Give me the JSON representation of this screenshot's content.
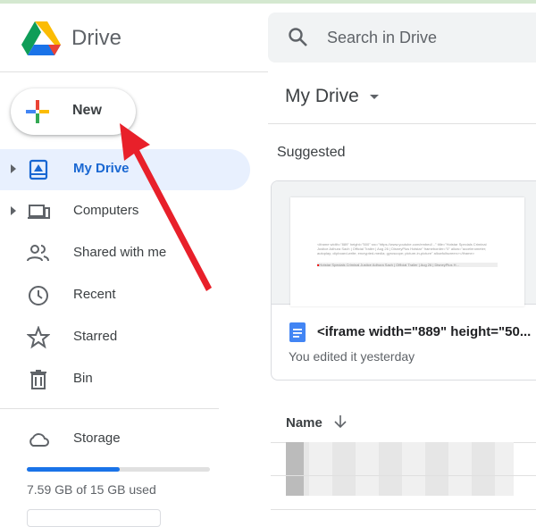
{
  "header": {
    "app_name": "Drive",
    "search_placeholder": "Search in Drive"
  },
  "new_button": {
    "label": "New"
  },
  "sidebar": {
    "items": [
      {
        "label": "My Drive",
        "icon": "my-drive-icon",
        "active": true
      },
      {
        "label": "Computers",
        "icon": "computers-icon"
      },
      {
        "label": "Shared with me",
        "icon": "people-icon"
      },
      {
        "label": "Recent",
        "icon": "clock-icon"
      },
      {
        "label": "Starred",
        "icon": "star-icon"
      },
      {
        "label": "Bin",
        "icon": "trash-icon"
      }
    ],
    "storage": {
      "label": "Storage",
      "used_text": "7.59 GB of 15 GB used",
      "fraction": 0.506
    }
  },
  "main": {
    "title": "My Drive",
    "suggested_label": "Suggested",
    "card": {
      "preview_text": "<iframe width=\"889\" height=\"500\" src=\"https://www.youtube.com/embed/...\" title=\"Hotstar Specials Criminal Justice Adhura Sach | Official Trailer | Aug 26 | DisneyPlus Hotstar\" frameborder=\"0\" allow=\"accelerometer; autoplay; clipboard-write; encrypted-media; gyroscope; picture-in-picture\" allowfullscreen></iframe>",
      "preview_link": "Hotstar Specials Criminal Justice Adhura Sach | Official Trailer | Aug 26 | DisneyPlus H...",
      "title": "<iframe width=\"889\" height=\"50...",
      "subtitle": "You edited it yesterday"
    },
    "sort_column": "Name"
  },
  "colors": {
    "accent": "#1a73e8",
    "active_bg": "#e8f0fe",
    "arrow": "#e8202a"
  }
}
